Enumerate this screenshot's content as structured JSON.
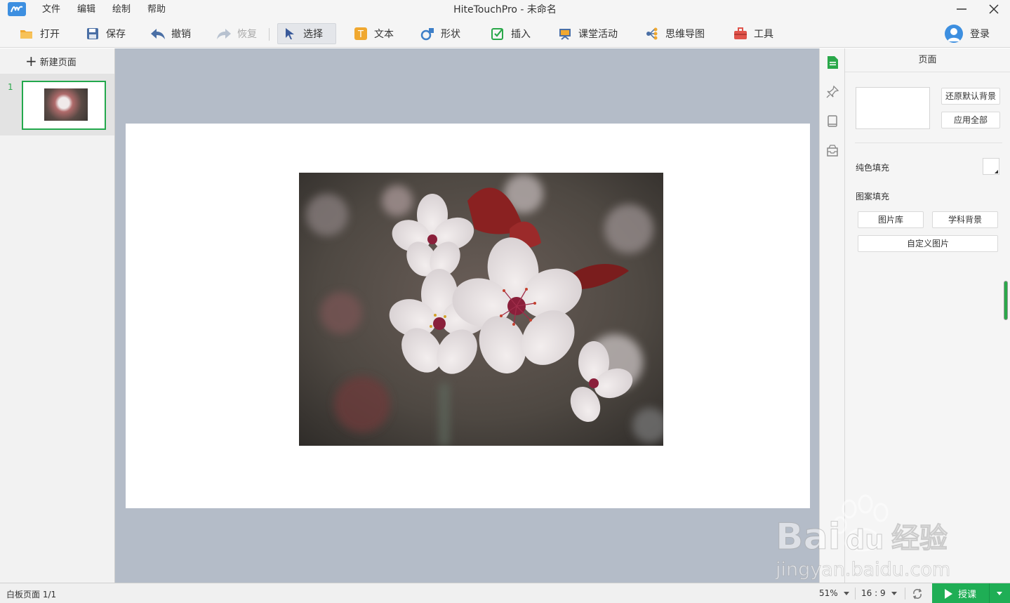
{
  "window": {
    "title": "HiteTouchPro - 未命名",
    "menu": [
      "文件",
      "编辑",
      "绘制",
      "帮助"
    ]
  },
  "toolbar": {
    "open": "打开",
    "save": "保存",
    "undo": "撤销",
    "redo": "恢复",
    "select": "选择",
    "text": "文本",
    "shape": "形状",
    "insert": "插入",
    "class_activity": "课堂活动",
    "mind_map": "思维导图",
    "tools": "工具",
    "login": "登录"
  },
  "pages_panel": {
    "new_page": "新建页面",
    "pages": [
      {
        "number": "1"
      }
    ]
  },
  "properties": {
    "title": "页面",
    "restore_default_bg": "还原默认背景",
    "apply_all": "应用全部",
    "solid_fill": "纯色填充",
    "pattern_fill": "图案填充",
    "image_library": "图片库",
    "subject_background": "学科背景",
    "custom_image": "自定义图片"
  },
  "statusbar": {
    "page_info": "白板页面 1/1",
    "zoom": "51%",
    "aspect_ratio": "16 : 9",
    "teach_button": "授课"
  },
  "watermark": {
    "brand": "Bai",
    "brand2": "du",
    "cn": "经验",
    "url": "jingyan.baidu.com"
  },
  "colors": {
    "accent_green": "#1fae55",
    "canvas_bg": "#b4bcc8",
    "brand_blue": "#3d8fe0"
  }
}
